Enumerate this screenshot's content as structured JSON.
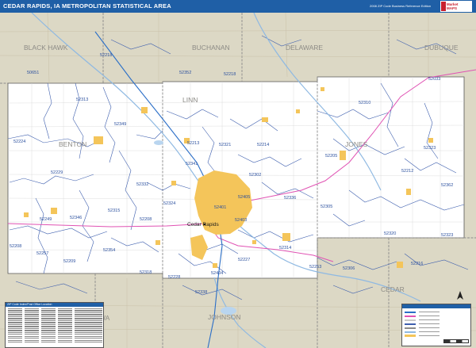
{
  "header": {
    "title": "CEDAR RAPIDS, IA METROPOLITAN STATISTICAL AREA",
    "edition": "2008 ZIP Code Business Reference Edition"
  },
  "colors": {
    "header_bg": "#1f5fa6",
    "msa_area": "#ffffff",
    "outside_area": "#dcd8c5",
    "urban": "#f4c55a",
    "zip_boundary": "#3e5fae",
    "county_boundary": "#7a7a7a",
    "highway": "#e052b3",
    "water": "#8fb9e2",
    "roads": "#c9c9c9"
  },
  "counties": [
    {
      "name": "BLACK HAWK"
    },
    {
      "name": "BUCHANAN"
    },
    {
      "name": "DELAWARE"
    },
    {
      "name": "DUBUQUE"
    },
    {
      "name": "LINN"
    },
    {
      "name": "BENTON"
    },
    {
      "name": "JONES"
    },
    {
      "name": "JOHNSON"
    },
    {
      "name": "CEDAR"
    },
    {
      "name": "IOWA"
    }
  ],
  "cities": [
    {
      "name": "Cedar Rapids"
    }
  ],
  "zip_codes": [
    "52218",
    "50651",
    "52352",
    "52218",
    "52033",
    "52313",
    "52310",
    "52349",
    "52213",
    "52224",
    "52321",
    "52214",
    "52205",
    "52323",
    "52341",
    "52229",
    "52332",
    "52212",
    "52302",
    "52324",
    "52362",
    "52336",
    "52405",
    "52401",
    "52249",
    "52346",
    "52315",
    "52208",
    "52403",
    "52305",
    "52320",
    "52323",
    "52208",
    "52257",
    "52354",
    "52209",
    "52314",
    "52216",
    "52227",
    "52253",
    "52306",
    "52318",
    "52228",
    "52404",
    "52338"
  ],
  "icons": {
    "north_arrow": "north-arrow-icon",
    "logo": "market-maps-logo"
  },
  "zip_index": {
    "title": "ZIP Code Index/Post Office Location"
  },
  "legend": {
    "title": "Map Legend"
  },
  "logo": {
    "line1": "Market",
    "line2": "MAPS",
    "line3": "Maps"
  }
}
